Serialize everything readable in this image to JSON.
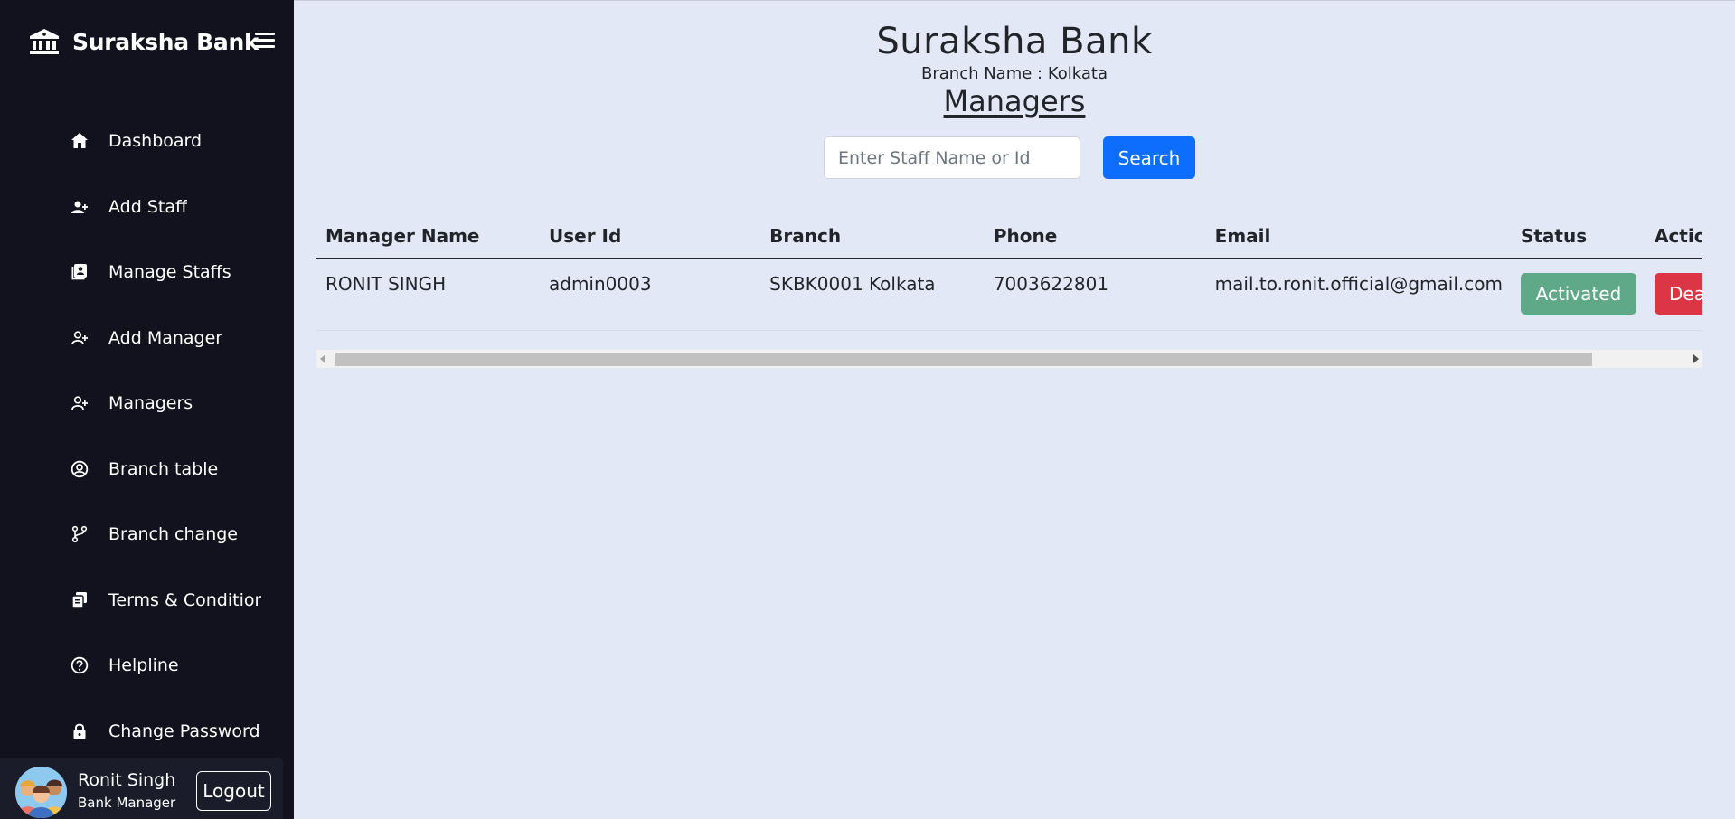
{
  "sidebar": {
    "brand": "Suraksha Bank",
    "items": [
      {
        "label": "Dashboard",
        "icon": "home-icon"
      },
      {
        "label": "Add Staff",
        "icon": "user-plus-icon"
      },
      {
        "label": "Manage Staffs",
        "icon": "id-card-icon"
      },
      {
        "label": "Add Manager",
        "icon": "user-plus-icon"
      },
      {
        "label": "Managers",
        "icon": "user-plus-icon"
      },
      {
        "label": "Branch table",
        "icon": "user-circle-icon"
      },
      {
        "label": "Branch change",
        "icon": "git-branch-icon"
      },
      {
        "label": "Terms & Conditions",
        "icon": "documents-icon"
      },
      {
        "label": "Helpline",
        "icon": "question-circle-icon"
      },
      {
        "label": "Change Password",
        "icon": "lock-icon"
      }
    ],
    "profile": {
      "name": "Ronit Singh",
      "role": "Bank Manager",
      "logout_label": "Logout"
    }
  },
  "header": {
    "title": "Suraksha Bank",
    "branch_line": "Branch Name : Kolkata",
    "page_heading": "Managers"
  },
  "search": {
    "placeholder": "Enter Staff Name or Id",
    "button_label": "Search"
  },
  "table": {
    "columns": [
      "Manager Name",
      "User Id",
      "Branch",
      "Phone",
      "Email",
      "Status",
      "Action"
    ],
    "rows": [
      {
        "name": "RONIT SINGH",
        "user_id": "admin0003",
        "branch": "SKBK0001 Kolkata",
        "phone": "7003622801",
        "email": "mail.to.ronit.official@gmail.com",
        "status": "Activated",
        "action": "Deactivate"
      }
    ]
  },
  "colors": {
    "sidebar_bg": "#11121d",
    "main_bg": "#e3e8f6",
    "primary": "#0d6efd",
    "status_active": "#5fa888",
    "danger": "#dc3545"
  }
}
